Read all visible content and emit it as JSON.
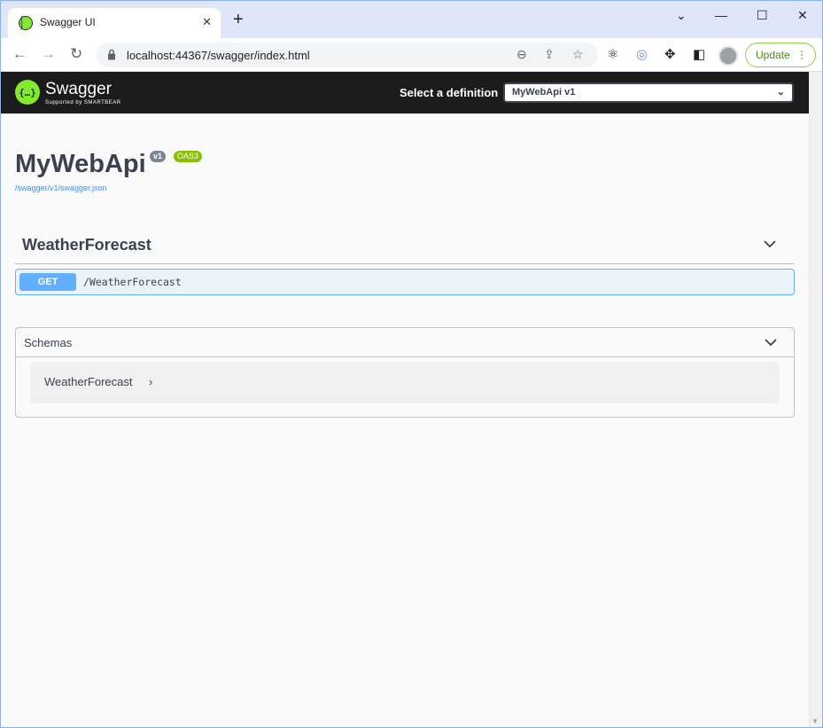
{
  "browser": {
    "tab_title": "Swagger UI",
    "tab_favicon": "{ }",
    "tab_close": "✕",
    "new_tab": "+",
    "window_controls": {
      "chevron": "⌄",
      "minimize": "—",
      "maximize": "☐",
      "close": "✕"
    },
    "url": "localhost:44367/swagger/index.html",
    "update_label": "Update",
    "update_menu": "⋮",
    "icons": {
      "back": "←",
      "forward": "→",
      "reload": "↻",
      "zoom": "⊖",
      "share": "⇪",
      "bookmark": "☆",
      "extension_react": "⚛",
      "extension_2": "◎",
      "extensions": "✥",
      "sidepanel": "◧"
    }
  },
  "swagger": {
    "logo_glyph": "{…}",
    "brand": "Swagger",
    "brand_sub": "Supported by SMARTBEAR",
    "select_definition_label": "Select a definition",
    "selected_definition": "MyWebApi v1",
    "select_chevron": "⌄",
    "api_title": "MyWebApi",
    "version_badge": "v1",
    "oas_badge": "OAS3",
    "spec_link": "/swagger/v1/swagger.json",
    "tags": [
      {
        "name": "WeatherForecast",
        "operations": [
          {
            "method": "GET",
            "path": "/WeatherForecast"
          }
        ]
      }
    ],
    "schemas": {
      "title": "Schemas",
      "models": [
        {
          "name": "WeatherForecast",
          "arrow": "›"
        }
      ]
    },
    "colors": {
      "topbar": "#1b1b1b",
      "brand_green": "#85ea2d",
      "get_method": "#61affe",
      "oas_badge": "#89bf04",
      "text": "#3b4151",
      "link": "#4990e2"
    }
  }
}
